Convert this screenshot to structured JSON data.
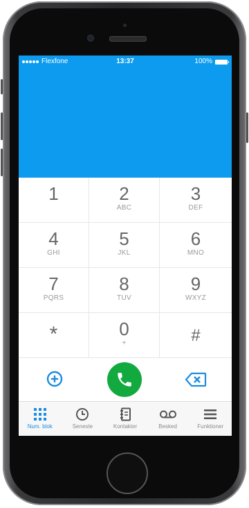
{
  "status_bar": {
    "carrier": "Flexfone",
    "time": "13:37",
    "battery": "100%"
  },
  "keypad": {
    "rows": [
      [
        {
          "digit": "1",
          "letters": ""
        },
        {
          "digit": "2",
          "letters": "ABC"
        },
        {
          "digit": "3",
          "letters": "DEF"
        }
      ],
      [
        {
          "digit": "4",
          "letters": "GHI"
        },
        {
          "digit": "5",
          "letters": "JKL"
        },
        {
          "digit": "6",
          "letters": "MNO"
        }
      ],
      [
        {
          "digit": "7",
          "letters": "PQRS"
        },
        {
          "digit": "8",
          "letters": "TUV"
        },
        {
          "digit": "9",
          "letters": "WXYZ"
        }
      ],
      [
        {
          "digit": "*",
          "letters": ""
        },
        {
          "digit": "0",
          "letters": "+"
        },
        {
          "digit": "#",
          "letters": ""
        }
      ]
    ]
  },
  "actions": {
    "add_icon": "plus-circle-icon",
    "call_icon": "phone-icon",
    "delete_icon": "backspace-icon"
  },
  "tabs": [
    {
      "label": "Num. blok",
      "icon": "keypad-grid-icon",
      "active": true
    },
    {
      "label": "Seneste",
      "icon": "clock-icon",
      "active": false
    },
    {
      "label": "Kontakter",
      "icon": "contacts-book-icon",
      "active": false
    },
    {
      "label": "Besked",
      "icon": "voicemail-icon",
      "active": false
    },
    {
      "label": "Funktioner",
      "icon": "menu-icon",
      "active": false
    }
  ],
  "colors": {
    "display": "#0c9bef",
    "call_button": "#12a93f",
    "accent": "#1b8be0"
  }
}
